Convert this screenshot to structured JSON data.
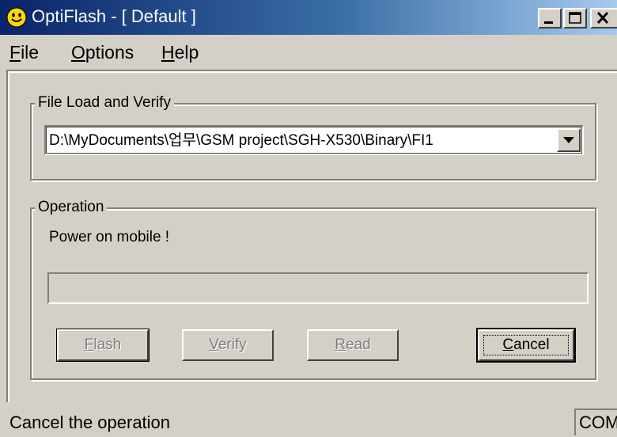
{
  "window": {
    "title": "OptiFlash - [ Default ]",
    "colors": {
      "titlebar_start": "#0a246a",
      "titlebar_end": "#a6caf0",
      "face": "#d4d0c8"
    },
    "controls": {
      "minimize_icon": "minimize-icon",
      "maximize_icon": "maximize-icon",
      "close_icon": "close-icon"
    }
  },
  "menu": {
    "items": [
      {
        "label_mnemonic": "F",
        "label_rest": "ile"
      },
      {
        "label_mnemonic": "O",
        "label_rest": "ptions"
      },
      {
        "label_mnemonic": "H",
        "label_rest": "elp"
      }
    ]
  },
  "file_group": {
    "legend": "File Load and Verify",
    "file_path": "D:\\MyDocuments\\업무\\GSM project\\SGH-X530\\Binary\\FI1"
  },
  "operation_group": {
    "legend": "Operation",
    "status_message": "Power on mobile !",
    "progress": 0,
    "buttons": {
      "flash": {
        "mnemonic": "F",
        "rest": "lash"
      },
      "verify": {
        "mnemonic": "V",
        "rest": "erify"
      },
      "read": {
        "mnemonic": "R",
        "rest": "ead"
      },
      "cancel": {
        "mnemonic": "C",
        "rest": "ancel"
      }
    }
  },
  "statusbar": {
    "message": "Cancel the operation",
    "pane": "COM"
  }
}
